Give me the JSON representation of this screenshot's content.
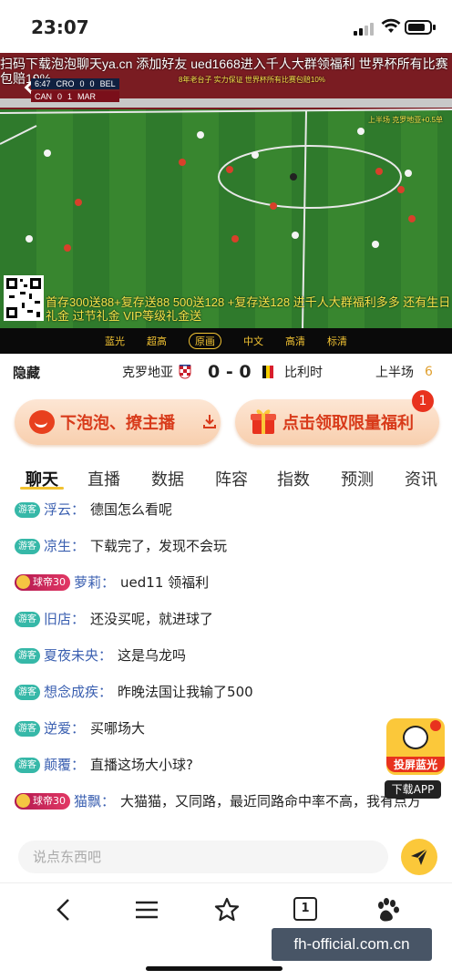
{
  "status_bar": {
    "time": "23:07"
  },
  "video": {
    "marquee": "扫码下载泡泡聊天ya.cn 添加好友 ued1668进入千人大群领福利 世界杯所有比赛包赔10%",
    "overlay_small_1": "8年老台子 实力保证 世界杯所有比赛包赔10%",
    "overlay_small_2": "上半场 克罗地亚+0.5单",
    "score_rows": [
      {
        "minute": "6:47",
        "team_a": "CRO",
        "score_a": "0",
        "score_b": "0",
        "team_b": "BEL"
      },
      {
        "minute": "",
        "team_a": "CAN",
        "score_a": "0",
        "score_b": "1",
        "team_b": "MAR"
      }
    ],
    "bottom_promo": "首存300送88+复存送88 500送128 +复存送128 进千人大群福利多多 还有生日礼金 过节礼金 VIP等级礼金送"
  },
  "quality_options": [
    "蓝光",
    "超高",
    "原画",
    "中文",
    "高清",
    "标清"
  ],
  "quality_active_index": 2,
  "match": {
    "hide_label": "隐藏",
    "team_home": "克罗地亚",
    "score": "0 - 0",
    "team_away": "比利时",
    "period": "上半场",
    "count": "6"
  },
  "banners": {
    "left_label": "下泡泡、撩主播",
    "right_label": "点击领取限量福利",
    "badge": "1"
  },
  "tabs": [
    "聊天",
    "直播",
    "数据",
    "阵容",
    "指数",
    "预测",
    "资讯"
  ],
  "chat": [
    {
      "tag": "游客",
      "level": "",
      "name": "浮云",
      "text": "德国怎么看呢"
    },
    {
      "tag": "游客",
      "level": "",
      "name": "凉生",
      "text": "下载完了，发现不会玩"
    },
    {
      "tag": "",
      "level": "球帝30",
      "name": "萝莉",
      "text": "ued11 领福利"
    },
    {
      "tag": "游客",
      "level": "",
      "name": "旧店",
      "text": "还没买呢，就进球了"
    },
    {
      "tag": "游客",
      "level": "",
      "name": "夏夜未央",
      "text": "这是乌龙吗"
    },
    {
      "tag": "游客",
      "level": "",
      "name": "想念成疾",
      "text": "昨晚法国让我输了500"
    },
    {
      "tag": "游客",
      "level": "",
      "name": "逆爱",
      "text": "买哪场大"
    },
    {
      "tag": "游客",
      "level": "",
      "name": "颠覆",
      "text": "直播这场大小球?"
    },
    {
      "tag": "",
      "level": "球帝30",
      "name": "猫飘",
      "text": "大猫猫，又同路，最近同路命中率不高，我有点方"
    }
  ],
  "floating": {
    "app_label": "投屏蓝光",
    "download_label": "下载APP"
  },
  "input": {
    "placeholder": "说点东西吧"
  },
  "browser": {
    "tab_count": "1"
  },
  "watermark": "fh-official.com.cn",
  "colors": {
    "accent": "#fbc83a",
    "brand_red": "#d83a1a",
    "guest_tag": "#36b8a8"
  }
}
